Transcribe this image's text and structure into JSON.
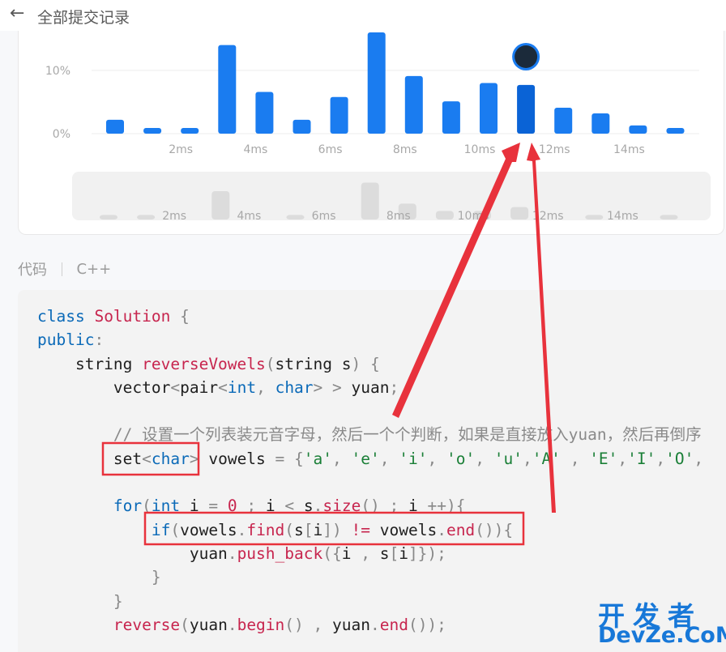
{
  "header": {
    "back_icon": "arrow-left-icon",
    "title": "全部提交记录"
  },
  "chart_data": {
    "type": "bar",
    "yticks": [
      "10%",
      "0%"
    ],
    "ytick_values": [
      10,
      0
    ],
    "ylim": [
      0,
      16
    ],
    "xticks": [
      "2ms",
      "4ms",
      "6ms",
      "8ms",
      "10ms",
      "12ms",
      "14ms"
    ],
    "values": [
      2.2,
      0.9,
      0.9,
      14,
      6.6,
      2.2,
      5.8,
      16,
      9.1,
      5.1,
      8,
      7.7,
      4.1,
      3.2,
      1.3,
      0.9
    ],
    "highlight_index": 11,
    "bar_color": "#1a7cf0",
    "highlight_color": "#0a63d6",
    "grid": true,
    "overview_values": [
      0.8,
      0.8,
      0,
      5,
      0,
      0.8,
      0,
      6.5,
      2.8,
      1.5,
      1.5,
      2.2,
      0,
      0.8,
      0,
      0.8
    ]
  },
  "language": {
    "label": "代码",
    "value": "C++"
  },
  "code_lines": [
    "class Solution {",
    "public:",
    "string reverseVowels(string s) {",
    "vector<pair<int, char> > yuan;",
    "",
    "// 设置一个列表装元音字母，然后一个个判断，如果是直接放入yuan，然后再倒序",
    "set<char> vowels = {'a', 'e', 'i', 'o', 'u','A' , 'E','I','O',",
    "",
    "for(int i = 0 ; i < s.size() ; i ++){",
    "if(vowels.find(s[i]) != vowels.end()){",
    "yuan.push_back({i , s[i]});",
    "}",
    "}",
    "reverse(yuan.begin() , yuan.end());"
  ],
  "watermark": {
    "line1": "开发者",
    "line2": "DevZe.CoM"
  },
  "colors": {
    "accent": "#1a7cf0",
    "annotation": "#e8323c"
  }
}
